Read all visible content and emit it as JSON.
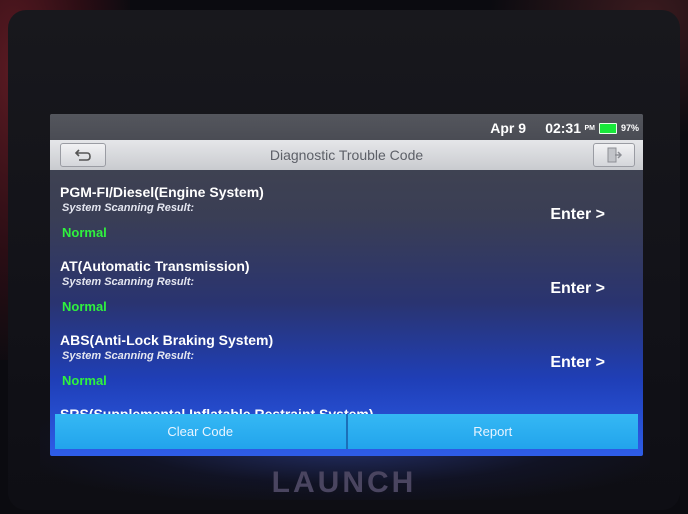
{
  "status_bar": {
    "date": "Apr 9",
    "time": "02:31",
    "ampm": "PM",
    "battery_percent": "97%",
    "battery_color": "#18e83a"
  },
  "header": {
    "title": "Diagnostic Trouble Code",
    "back_icon": "back-arrow-icon",
    "exit_icon": "exit-door-icon"
  },
  "systems": [
    {
      "name": "PGM-FI/Diesel(Engine System)",
      "scan_label": "System Scanning Result:",
      "status": "Normal",
      "enter_label": "Enter >"
    },
    {
      "name": "AT(Automatic Transmission)",
      "scan_label": "System Scanning Result:",
      "status": "Normal",
      "enter_label": "Enter >"
    },
    {
      "name": "ABS(Anti-Lock Braking System)",
      "scan_label": "System Scanning Result:",
      "status": "Normal",
      "enter_label": "Enter >"
    },
    {
      "name": "SRS(Supplemental Inflatable Restraint System)"
    }
  ],
  "actions": {
    "clear_code": "Clear Code",
    "report": "Report"
  },
  "device": {
    "brand": "LAUNCH"
  },
  "colors": {
    "status_normal": "#2ff23e",
    "button_blue": "#22a4ec"
  }
}
